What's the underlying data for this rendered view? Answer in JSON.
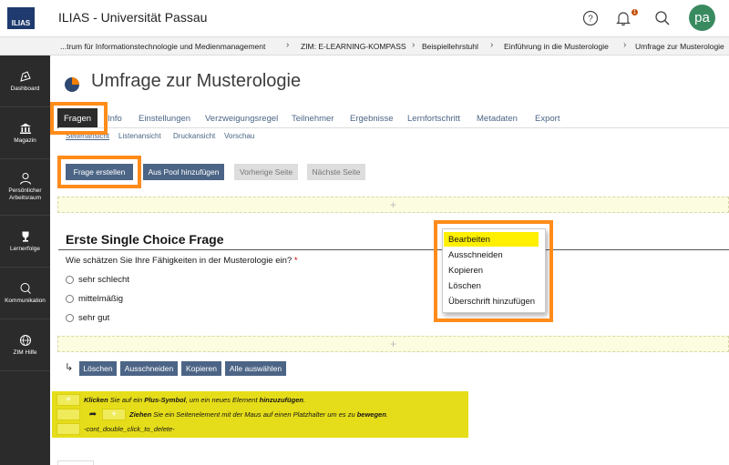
{
  "header": {
    "logo_text": "ILIAS",
    "title": "ILIAS - Universität Passau",
    "help_icon": "help-circle-icon",
    "notification_icon": "bell-icon",
    "notification_count": "1",
    "search_icon": "search-icon",
    "avatar_initials": "pa"
  },
  "breadcrumb": [
    "...trum für Informationstechnologie und Medienmanagement",
    "ZIM: E-LEARNING-KOMPASS",
    "Beispiellehrstuhl",
    "Einführung in die Musterologie",
    "Umfrage zur Musterologie"
  ],
  "sidebar": [
    {
      "label": "Dashboard",
      "icon": "dashboard-icon"
    },
    {
      "label": "Magazin",
      "icon": "bank-icon"
    },
    {
      "label": "Persönlicher Arbeitsraum",
      "icon": "user-icon"
    },
    {
      "label": "Lernerfolge",
      "icon": "trophy-icon"
    },
    {
      "label": "Kommunikation",
      "icon": "chat-icon"
    },
    {
      "label": "ZIM Hilfe",
      "icon": "globe-icon"
    }
  ],
  "page": {
    "title": "Umfrage zur Musterologie"
  },
  "tabs": [
    "Fragen",
    "Info",
    "Einstellungen",
    "Verzweigungsregel",
    "Teilnehmer",
    "Ergebnisse",
    "Lernfortschritt",
    "Metadaten",
    "Export"
  ],
  "subtabs": [
    "Seitenansicht",
    "Listenansicht",
    "Druckansicht",
    "Vorschau"
  ],
  "toolbar": {
    "create": "Frage erstellen",
    "from_pool": "Aus Pool hinzufügen",
    "prev": "Vorherige Seite",
    "next": "Nächste Seite"
  },
  "dropzone_symbol": "+",
  "question": {
    "title": "Erste Single Choice Frage",
    "text": "Wie schätzen Sie Ihre Fähigkeiten in der Musterologie ein?",
    "required_mark": "*",
    "options": [
      "sehr schlecht",
      "mittelmäßig",
      "sehr gut"
    ]
  },
  "context_menu": [
    "Bearbeiten",
    "Ausschneiden",
    "Kopieren",
    "Löschen",
    "Überschrift hinzufügen"
  ],
  "bottom_actions": [
    "Löschen",
    "Ausschneiden",
    "Kopieren",
    "Alle auswählen"
  ],
  "help": {
    "row1": {
      "b1": "Klicken",
      "t1": " Sie auf ein ",
      "b2": "Plus-Symbol",
      "t2": ", um ein neues Element ",
      "b3": "hinzuzufügen",
      "t3": "."
    },
    "row2": {
      "b1": "Ziehen",
      "t1": " Sie ein Seitenelement mit der Maus auf einen Platzhalter um es zu ",
      "b2": "bewegen",
      "t2": "."
    },
    "row3": "-cont_double_click_to_delete-"
  },
  "colors": {
    "accent_orange": "#ff8c1a",
    "button_blue": "#4c6586",
    "highlight_yellow": "#ffef00",
    "sidebar_dark": "#2b2b2b"
  }
}
